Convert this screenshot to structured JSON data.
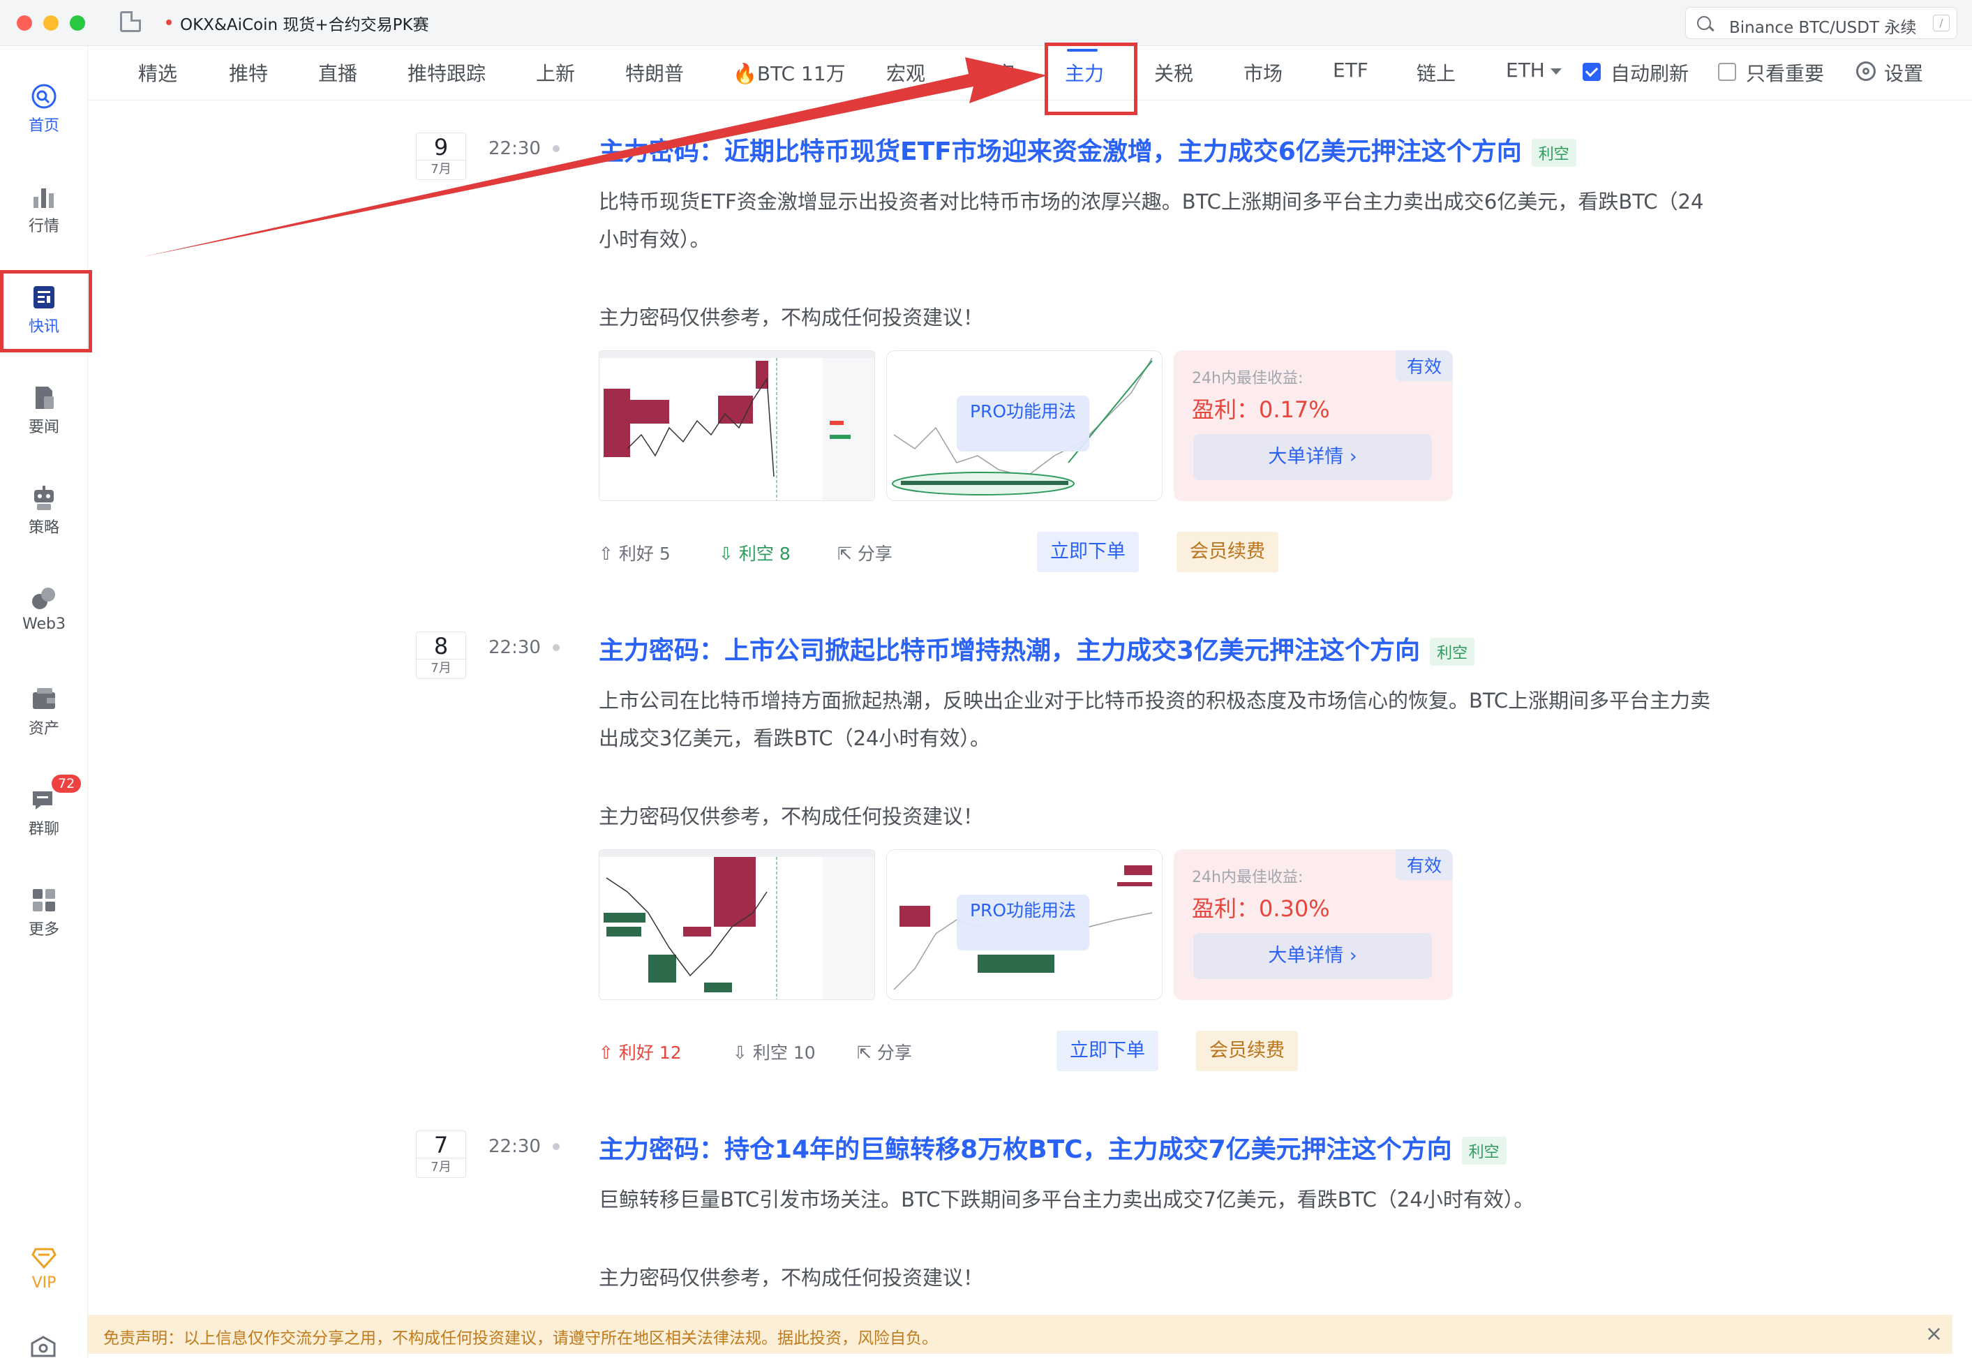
{
  "window": {
    "tab_title": "OKX&AiCoin 现货+合约交易PK赛",
    "search_placeholder": "Binance BTC/USDT 永续",
    "search_shortcut": "/"
  },
  "sidebar": {
    "items": [
      {
        "label": "首页",
        "icon": "home-icon"
      },
      {
        "label": "行情",
        "icon": "bar-chart-icon"
      },
      {
        "label": "快讯",
        "icon": "news-flash-icon"
      },
      {
        "label": "要闻",
        "icon": "document-icon"
      },
      {
        "label": "策略",
        "icon": "robot-icon"
      },
      {
        "label": "Web3",
        "icon": "web3-icon"
      },
      {
        "label": "资产",
        "icon": "wallet-icon"
      },
      {
        "label": "群聊",
        "icon": "chat-icon"
      },
      {
        "label": "更多",
        "icon": "grid-icon"
      },
      {
        "label": "VIP",
        "icon": "diamond-icon"
      }
    ],
    "chat_badge": "72",
    "active": "快讯"
  },
  "nav": {
    "tabs": [
      "精选",
      "推特",
      "直播",
      "推特跟踪",
      "上新",
      "特朗普",
      "🔥BTC 11万",
      "宏观",
      "独家",
      "主力",
      "关税",
      "市场",
      "ETF",
      "链上",
      "ETH"
    ],
    "active": "主力",
    "auto_refresh_label": "自动刷新",
    "auto_refresh_checked": true,
    "important_only_label": "只看重要",
    "important_only_checked": false,
    "settings_label": "设置"
  },
  "common": {
    "disclaimer_line": "主力密码仅供参考，不构成任何投资建议！",
    "pro_overlay": "PRO功能用法",
    "profit_label": "24h内最佳收益:",
    "valid_badge": "有效",
    "detail_button": "大单详情 ›",
    "share_label": "分享",
    "order_button": "立即下单",
    "renew_button": "会员续费"
  },
  "entries": [
    {
      "day": "9",
      "month": "7月",
      "time": "22:30",
      "title": "主力密码：近期比特币现货ETF市场迎来资金激增，主力成交6亿美元押注这个方向",
      "tag": "利空",
      "body": "比特币现货ETF资金激增显示出投资者对比特币市场的浓厚兴趣。BTC上涨期间多平台主力卖出成交6亿美元，看跌BTC（24小时有效）。",
      "profit": "盈利：0.17%",
      "bull_label": "利好 5",
      "bear_label": "利空 8"
    },
    {
      "day": "8",
      "month": "7月",
      "time": "22:30",
      "title": "主力密码：上市公司掀起比特币增持热潮，主力成交3亿美元押注这个方向",
      "tag": "利空",
      "body": "上市公司在比特币增持方面掀起热潮，反映出企业对于比特币投资的积极态度及市场信心的恢复。BTC上涨期间多平台主力卖出成交3亿美元，看跌BTC（24小时有效）。",
      "profit": "盈利：0.30%",
      "bull_label": "利好 12",
      "bear_label": "利空 10"
    },
    {
      "day": "7",
      "month": "7月",
      "time": "22:30",
      "title": "主力密码：持仓14年的巨鲸转移8万枚BTC，主力成交7亿美元押注这个方向",
      "tag": "利空",
      "body": "巨鲸转移巨量BTC引发市场关注。BTC下跌期间多平台主力卖出成交7亿美元，看跌BTC（24小时有效）。"
    }
  ],
  "footer": {
    "disclaimer": "免责声明：以上信息仅作交流分享之用，不构成任何投资建议，请遵守所在地区相关法律法规。据此投资，风险自负。"
  },
  "colors": {
    "accent": "#2a62f5",
    "bearish": "#2e9a5b",
    "bullish": "#e8453c",
    "annotation": "#e03a3a"
  }
}
